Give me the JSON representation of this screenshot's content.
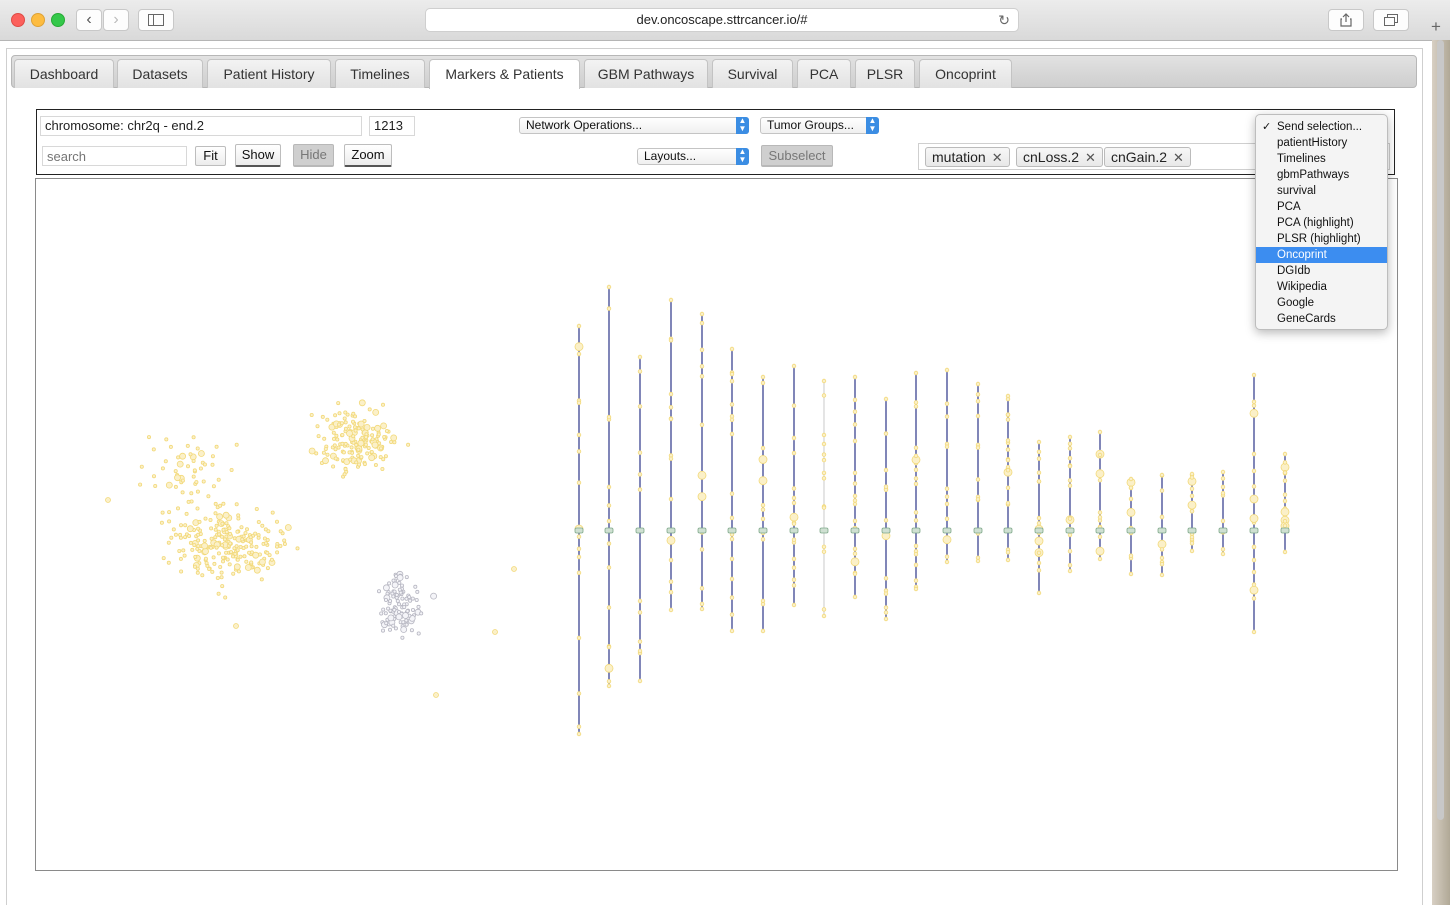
{
  "browser": {
    "url": "dev.oncoscape.sttrcancer.io/#",
    "back_glyph": "‹",
    "forward_glyph": "›",
    "reload_glyph": "↻",
    "new_tab_glyph": "+"
  },
  "tabs": [
    {
      "label": "Dashboard"
    },
    {
      "label": "Datasets"
    },
    {
      "label": "Patient History"
    },
    {
      "label": "Timelines"
    },
    {
      "label": "Markers & Patients",
      "active": true
    },
    {
      "label": "GBM Pathways"
    },
    {
      "label": "Survival"
    },
    {
      "label": "PCA"
    },
    {
      "label": "PLSR"
    },
    {
      "label": "Oncoprint"
    }
  ],
  "toolbar": {
    "chromosome_value": "chromosome: chr2q - end.2",
    "count_value": "1213",
    "search_placeholder": "search",
    "fit_label": "Fit",
    "show_label": "Show",
    "hide_label": "Hide",
    "zoom_label": "Zoom",
    "network_operations": "Network Operations...",
    "tumor_groups": "Tumor Groups...",
    "layouts": "Layouts...",
    "subselect_label": "Subselect",
    "tags": [
      "mutation",
      "cnLoss.2",
      "cnGain.2"
    ]
  },
  "send_selection": {
    "options": [
      "Send selection...",
      "patientHistory",
      "Timelines",
      "gbmPathways",
      "survival",
      "PCA",
      "PCA (highlight)",
      "PLSR (highlight)",
      "Oncoprint",
      "DGIdb",
      "Wikipedia",
      "Google",
      "GeneCards"
    ],
    "checked": "Send selection...",
    "highlighted": "Oncoprint"
  },
  "colors": {
    "accent": "#3c8df0",
    "chromosome_line": "#1a237e",
    "patient_node": "#f2d97a",
    "patient_node_gray": "#b7b7c2",
    "centromere": "#7fa88a"
  }
}
